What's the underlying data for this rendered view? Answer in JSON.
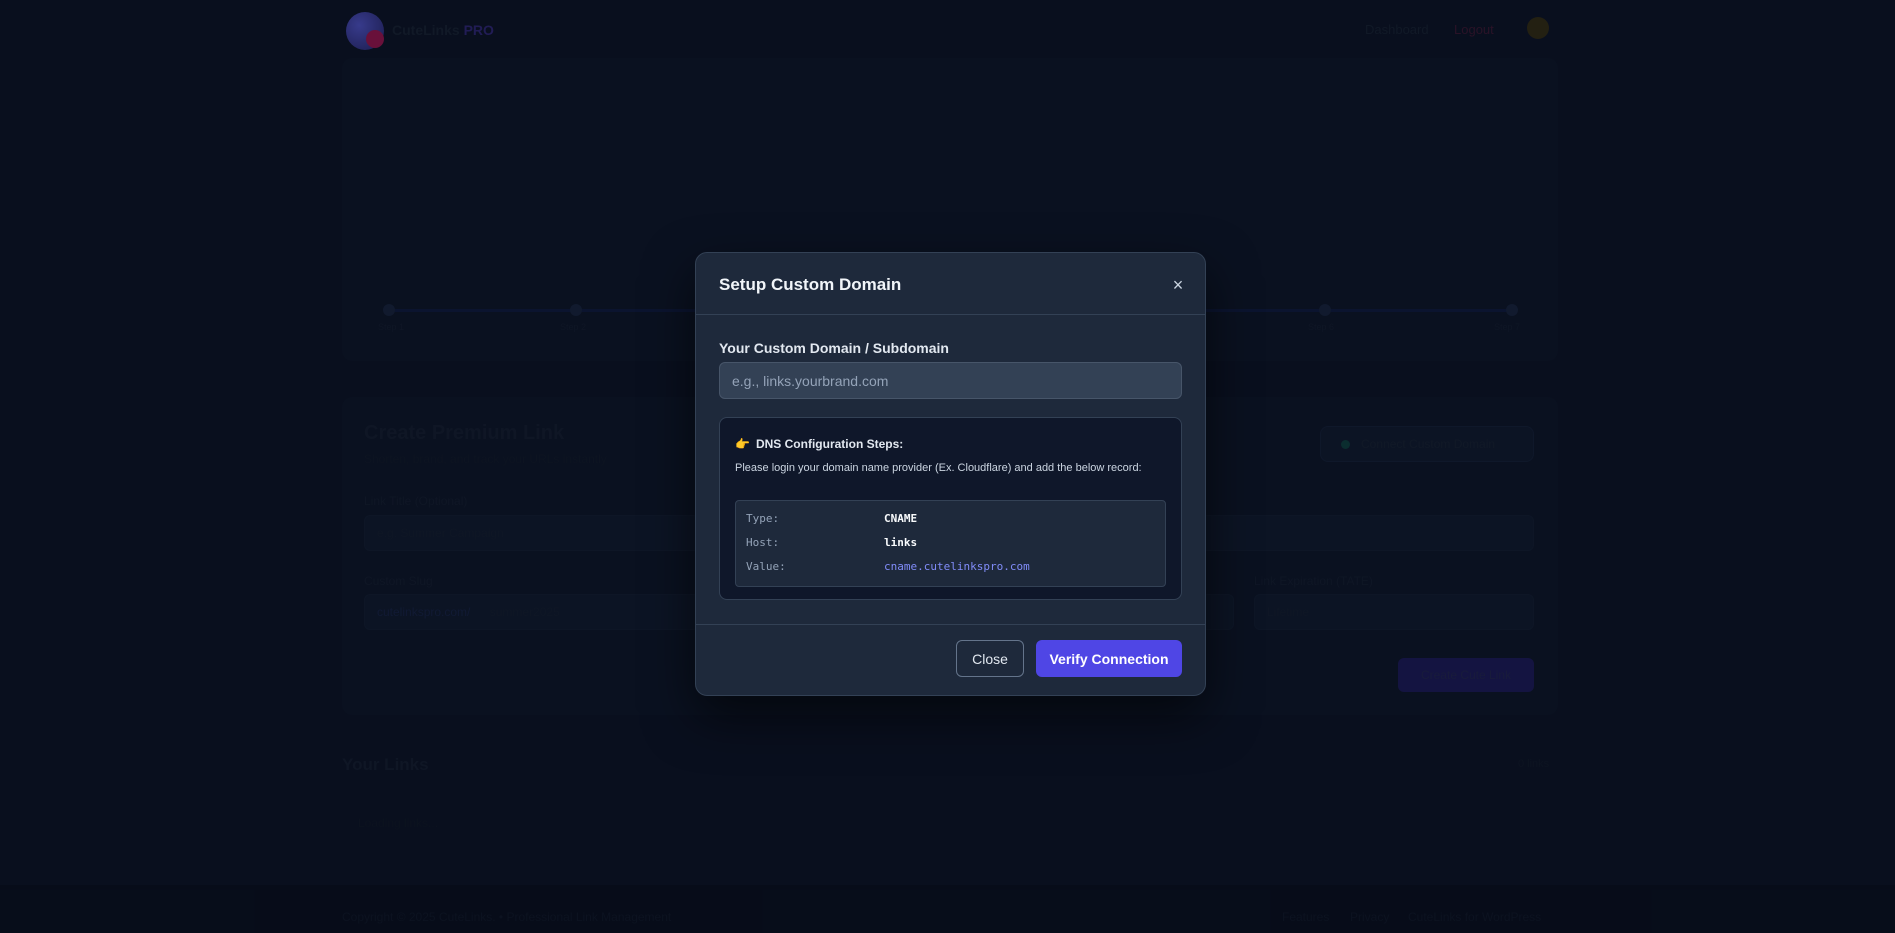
{
  "background": {
    "brand": {
      "name": "CuteLinks",
      "suffix": "PRO"
    },
    "nav": {
      "dashboard": "Dashboard",
      "logout": "Logout"
    },
    "timeline_labels": [
      "Step 1",
      "Step 2",
      "Step 3",
      "Step 4",
      "Step 5",
      "Step 6",
      "Step 7"
    ],
    "create": {
      "title": "Create Premium Link",
      "subtitle": "Shorten, brand, and track your URLs instantly",
      "connect_button": "Connect Custom Domain",
      "title_label": "Link Title (Optional)",
      "title_placeholder": "e.g. Summer Campaign",
      "slug_label": "Custom Slug",
      "slug_prefix": "cutelinkspro.com/",
      "slug_placeholder": "summer2025",
      "expiry_label": "Link Expiration (TATE)",
      "expiry_value": "Lifetime",
      "create_button": "Create Cute Link"
    },
    "links": {
      "title": "Your Links",
      "count": "0 links",
      "empty": "Loading links..."
    },
    "footer": {
      "copyright": "Copyright © 2025 CuteLinks. • Professional Link Management",
      "links": [
        "Features",
        "Privacy",
        "CuteLinks for WordPress"
      ]
    }
  },
  "modal": {
    "title": "Setup Custom Domain",
    "close_icon": "×",
    "domain_label": "Your Custom Domain / Subdomain",
    "domain_placeholder": "e.g., links.yourbrand.com",
    "dns": {
      "emoji": "👉",
      "heading": "DNS Configuration Steps:",
      "description": "Please login your domain name provider (Ex. Cloudflare) and add the below record:",
      "records": [
        {
          "key": "Type:",
          "value": "CNAME"
        },
        {
          "key": "Host:",
          "value": "links"
        },
        {
          "key": "Value:",
          "value": "cname.cutelinkspro.com"
        }
      ]
    },
    "close_button": "Close",
    "verify_button": "Verify Connection"
  },
  "colors": {
    "accent": "#4f46e5",
    "link": "#818cf8",
    "modal_bg": "#1e293b",
    "page_bg": "#0f172a"
  }
}
